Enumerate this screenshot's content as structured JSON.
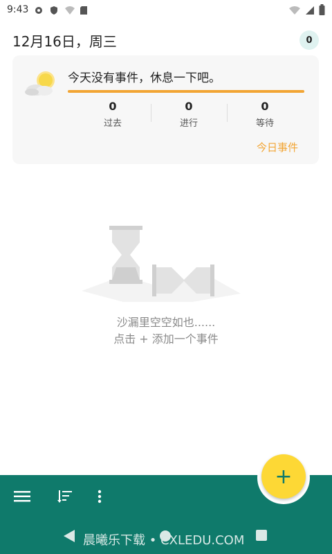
{
  "status_bar": {
    "time": "9:43"
  },
  "header": {
    "date": "12月16日，周三",
    "count": "0"
  },
  "card": {
    "message": "今天没有事件，休息一下吧。",
    "progress": 1.0,
    "stats": [
      {
        "value": "0",
        "label": "过去"
      },
      {
        "value": "0",
        "label": "进行"
      },
      {
        "value": "0",
        "label": "等待"
      }
    ],
    "today_link": "今日事件"
  },
  "empty_state": {
    "line1": "沙漏里空空如也......",
    "line2": "点击 + 添加一个事件"
  },
  "fab": {
    "label": "+"
  },
  "watermark": "晨曦乐下载 • CXLEDU.COM",
  "colors": {
    "accent": "#0f7a6b",
    "orange": "#f2a534",
    "fab": "#fdd835"
  }
}
